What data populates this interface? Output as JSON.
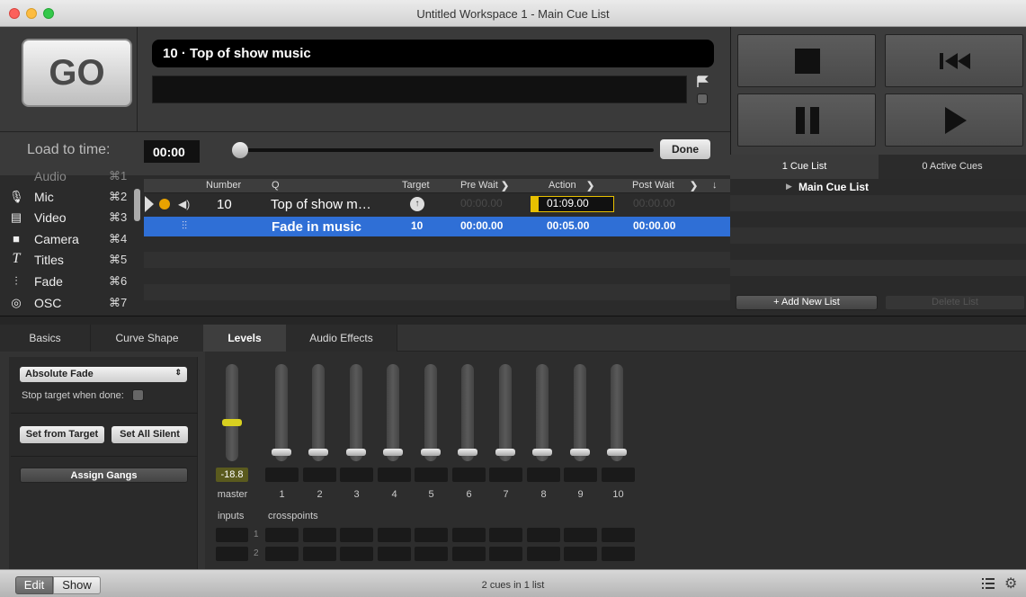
{
  "window": {
    "title": "Untitled Workspace 1 - Main Cue List"
  },
  "go": {
    "label": "GO"
  },
  "standby": {
    "cue_name": "10 · Top of show music"
  },
  "load": {
    "label": "Load to time:",
    "time": "00:00",
    "done_label": "Done"
  },
  "cue_lists_tabs": {
    "cue_list": "1 Cue List",
    "active": "0 Active Cues"
  },
  "cue_lists": {
    "items": [
      "Main Cue List"
    ],
    "add_label": "+ Add New List",
    "delete_label": "Delete List"
  },
  "toolbox": {
    "partial_top": {
      "label": "Audio",
      "shortcut": "⌘1"
    },
    "items": [
      {
        "icon": "microphone-icon",
        "glyph": "🎙",
        "label": "Mic",
        "shortcut": "⌘2"
      },
      {
        "icon": "film-icon",
        "glyph": "▤",
        "label": "Video",
        "shortcut": "⌘3"
      },
      {
        "icon": "camera-icon",
        "glyph": "■",
        "label": "Camera",
        "shortcut": "⌘4"
      },
      {
        "icon": "text-icon",
        "glyph": "T",
        "label": "Titles",
        "shortcut": "⌘5"
      },
      {
        "icon": "fader-icon",
        "glyph": "⫶",
        "label": "Fade",
        "shortcut": "⌘6"
      },
      {
        "icon": "osc-icon",
        "glyph": "◎",
        "label": "OSC",
        "shortcut": "⌘7"
      }
    ]
  },
  "cue_table": {
    "headers": {
      "number": "Number",
      "q": "Q",
      "target": "Target",
      "pre_wait": "Pre Wait",
      "action": "Action",
      "post_wait": "Post Wait"
    },
    "rows": [
      {
        "number": "10",
        "q": "Top of show m…",
        "target": "",
        "pre_wait": "00:00.00",
        "action": "01:09.00",
        "post_wait": "00:00.00",
        "type_icon": "speaker-icon",
        "selected": false
      },
      {
        "number": "",
        "q": "Fade in music",
        "target": "10",
        "pre_wait": "00:00.00",
        "action": "00:05.00",
        "post_wait": "00:00.00",
        "type_icon": "fader-icon",
        "selected": true
      }
    ]
  },
  "inspector": {
    "tabs": [
      "Basics",
      "Curve Shape",
      "Levels",
      "Audio Effects"
    ],
    "active_tab": "Levels",
    "fade_mode": "Absolute Fade",
    "stop_target_label": "Stop target when done:",
    "stop_target_checked": false,
    "set_from_target": "Set from Target",
    "set_all_silent": "Set All Silent",
    "assign_gangs": "Assign Gangs",
    "master_value": "-18.8",
    "master_label": "master",
    "channel_labels": [
      "1",
      "2",
      "3",
      "4",
      "5",
      "6",
      "7",
      "8",
      "9",
      "10"
    ],
    "inputs_label": "inputs",
    "crosspoints_label": "crosspoints",
    "input_rows": [
      "1",
      "2"
    ]
  },
  "footer": {
    "edit": "Edit",
    "show": "Show",
    "status": "2 cues in 1 list"
  },
  "colors": {
    "selection": "#2f6fd6",
    "accent_yellow": "#e8c000",
    "master_fader_yellow": "#d8d020"
  }
}
